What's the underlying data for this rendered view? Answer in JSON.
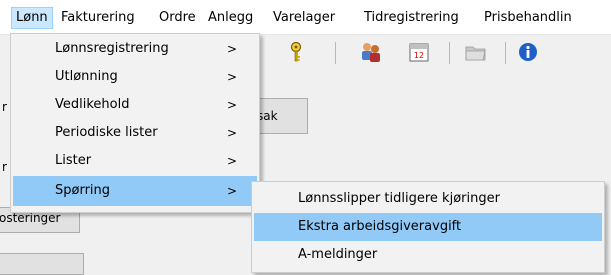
{
  "menubar": {
    "items": [
      {
        "label": "Lønn"
      },
      {
        "label": "Fakturering"
      },
      {
        "label": "Ordre"
      },
      {
        "label": "Anlegg"
      },
      {
        "label": "Varelager"
      },
      {
        "label": "Tidregistrering"
      },
      {
        "label": "Prisbehandlin"
      }
    ]
  },
  "toolbar": {
    "icons": [
      "key-icon",
      "users-icon",
      "calendar-icon",
      "folder-icon",
      "info-icon"
    ],
    "calendar_day": "12"
  },
  "background": {
    "sak_button": "sak",
    "posteringer_button": "osteringer",
    "frag_r": "r"
  },
  "lonn_menu": {
    "items": [
      {
        "label": "Lønnsregistrering",
        "submenu": ">"
      },
      {
        "label": "Utlønning",
        "submenu": ">"
      },
      {
        "label": "Vedlikehold",
        "submenu": ">"
      },
      {
        "label": "Periodiske lister",
        "submenu": ">"
      },
      {
        "label": "Lister",
        "submenu": ">"
      },
      {
        "label": "Spørring",
        "submenu": ">"
      }
    ]
  },
  "sporring_submenu": {
    "items": [
      {
        "label": "Lønnsslipper tidligere kjøringer"
      },
      {
        "label": "Ekstra arbeidsgiveravgift"
      },
      {
        "label": "A-meldinger"
      }
    ]
  },
  "colors": {
    "menu_highlight": "#91c9f7",
    "menubar_active": "#cce8ff"
  }
}
